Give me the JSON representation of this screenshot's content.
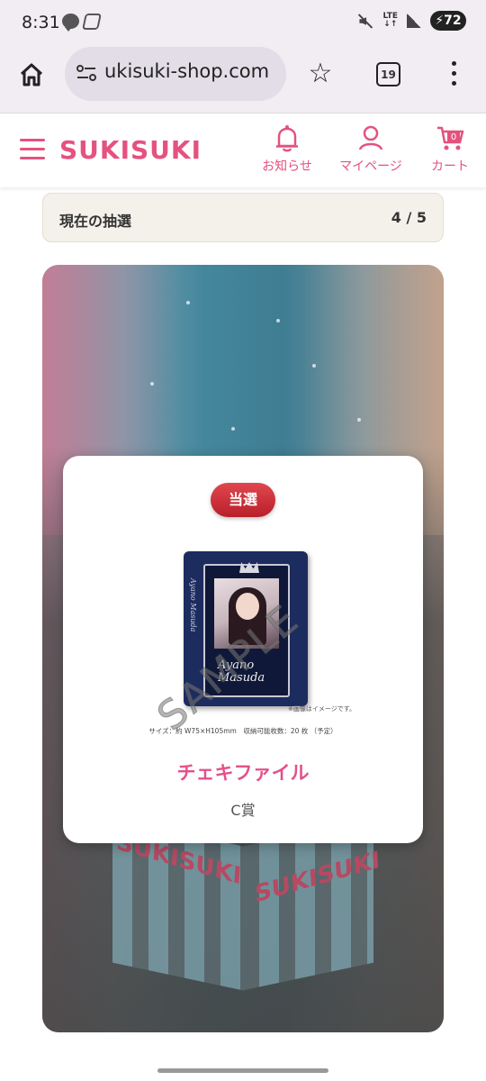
{
  "status_bar": {
    "time": "8:31",
    "network": "LTE",
    "battery": "72"
  },
  "browser": {
    "url": "ukisuki-shop.com",
    "tab_count": "19"
  },
  "site": {
    "logo": "SUKISUKI",
    "nav": {
      "notice": "お知らせ",
      "mypage": "マイページ",
      "cart": "カート",
      "cart_count": "0"
    }
  },
  "lottery": {
    "current_label": "現在の抽選",
    "current_count": "4 / 5"
  },
  "stage": {
    "box_text_left": "SUKISUKI",
    "box_text_right": "SUKISUKI"
  },
  "prize": {
    "badge": "当選",
    "watermark": "SAMPLE",
    "product_signature": "Ayano Masuda",
    "image_note": "※画像はイメージです。",
    "size_note": "サイズ：約 W75×H105mm　収納可能枚数：20 枚 （予定）",
    "name": "チェキファイル",
    "rank": "C賞"
  },
  "colors": {
    "brand_pink": "#e5527f",
    "badge_red": "#c8262f",
    "prize_name": "#e4508a"
  }
}
